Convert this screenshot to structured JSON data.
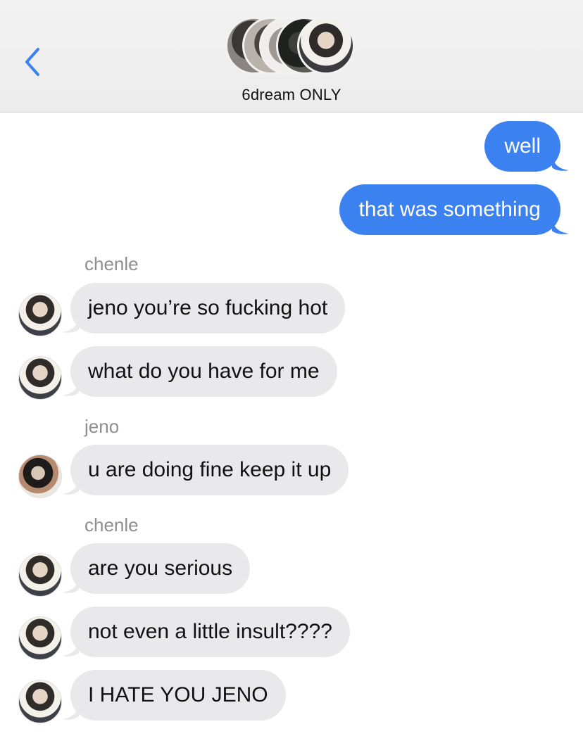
{
  "header": {
    "title": "6dream ONLY",
    "back_icon": "chevron-left-icon",
    "accent": "#3b82f0",
    "member_avatars": 5
  },
  "messages": [
    {
      "direction": "out",
      "text": "well"
    },
    {
      "direction": "out",
      "text": "that was something"
    },
    {
      "direction": "in",
      "sender": "chenle",
      "text": "jeno you’re so fucking hot"
    },
    {
      "direction": "in",
      "text": "what do you have for me"
    },
    {
      "direction": "in",
      "sender": "jeno",
      "text": "u are doing fine keep it up"
    },
    {
      "direction": "in",
      "sender": "chenle",
      "text": "are you serious"
    },
    {
      "direction": "in",
      "text": "not even a little insult????"
    },
    {
      "direction": "in",
      "text": "I HATE YOU JENO"
    }
  ],
  "colors": {
    "outgoing_bubble": "#3b82f0",
    "incoming_bubble": "#e9e9eb",
    "sender_label": "#8e8e93"
  }
}
